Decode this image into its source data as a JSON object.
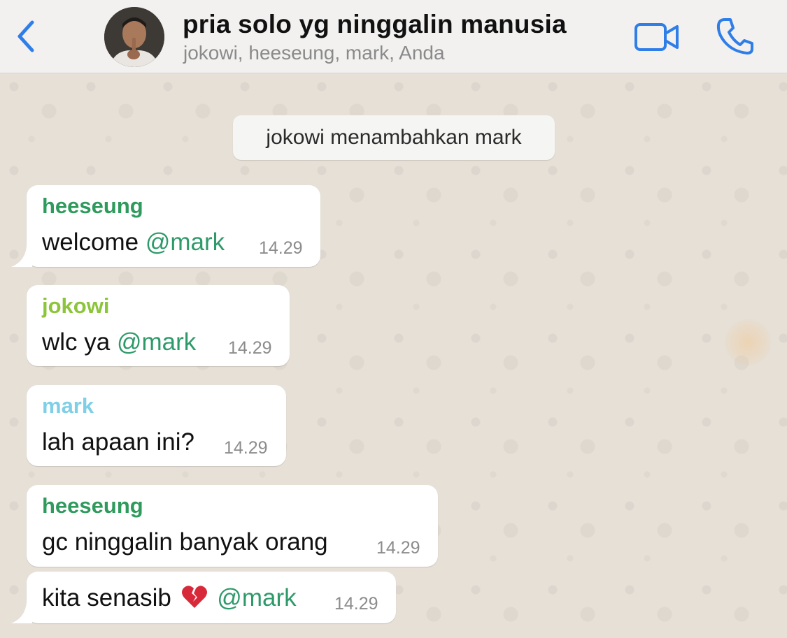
{
  "header": {
    "title": "pria solo yg ninggalin manusia",
    "members": "jokowi, heeseung, mark, Anda"
  },
  "system_message": "jokowi menambahkan mark",
  "messages": [
    {
      "sender": "heeseung",
      "sender_color": "#2e9a5c",
      "text": "welcome",
      "mention": "@mark",
      "time": "14.29"
    },
    {
      "sender": "jokowi",
      "sender_color": "#8cc43a",
      "text": "wlc ya",
      "mention": "@mark",
      "time": "14.29"
    },
    {
      "sender": "mark",
      "sender_color": "#7fcfe6",
      "text": "lah apaan ini?",
      "time": "14.29"
    },
    {
      "sender": "heeseung",
      "sender_color": "#2e9a5c",
      "text": "gc ninggalin banyak orang",
      "time": "14.29"
    },
    {
      "text": "kita senasib",
      "emoji": "broken-heart",
      "mention": "@mark",
      "time": "14.29"
    }
  ],
  "colors": {
    "accent": "#2f7ee8",
    "mention": "#2e9a6a",
    "bubble": "#ffffff",
    "chat_background": "#e6e0d7"
  },
  "icons": [
    "chevron-left-icon",
    "video-camera-icon",
    "phone-icon",
    "broken-heart-icon"
  ]
}
